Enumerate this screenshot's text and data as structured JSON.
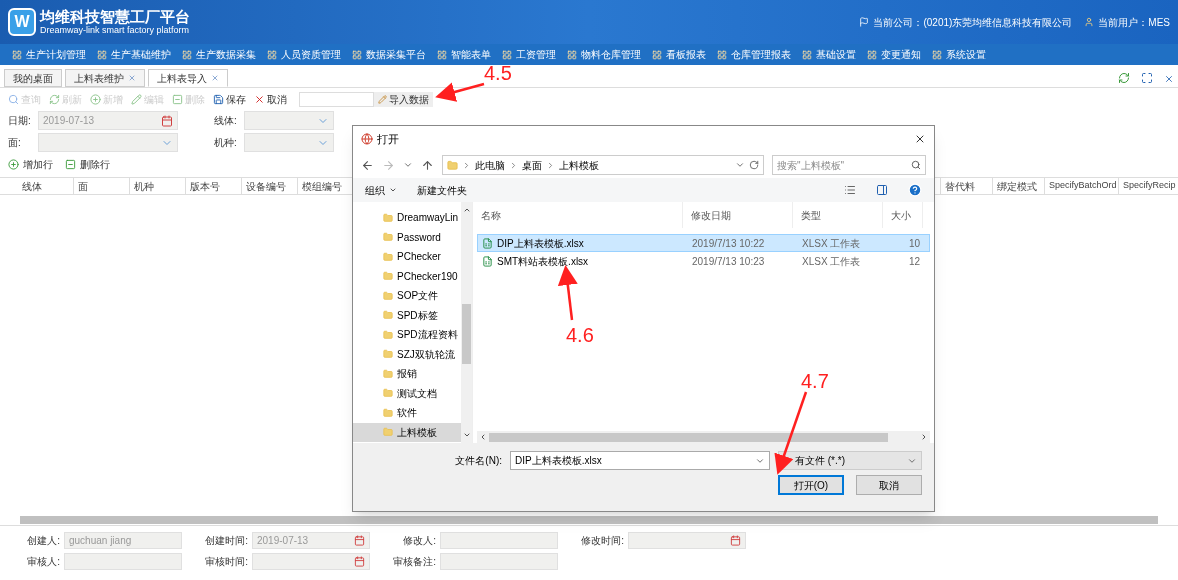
{
  "header": {
    "logo_letter": "W",
    "title": "均维科技智慧工厂平台",
    "subtitle": "Dreamway-link smart factory platform",
    "company": "当前公司：(0201)东莞均维信息科技有限公司",
    "user": "当前用户：MES"
  },
  "menu": [
    "生产计划管理",
    "生产基础维护",
    "生产数据采集",
    "人员资质管理",
    "数据采集平台",
    "智能表单",
    "工资管理",
    "物料仓库管理",
    "看板报表",
    "仓库管理报表",
    "基础设置",
    "变更通知",
    "系统设置"
  ],
  "tabs": [
    {
      "label": "我的桌面",
      "closable": false,
      "selected": false
    },
    {
      "label": "上料表维护",
      "closable": true,
      "selected": false
    },
    {
      "label": "上料表导入",
      "closable": true,
      "selected": true
    }
  ],
  "toolbar": [
    {
      "kind": "search",
      "label": "查询",
      "disabled": true
    },
    {
      "kind": "refresh",
      "label": "刷新",
      "disabled": true
    },
    {
      "kind": "add",
      "label": "新增",
      "disabled": true
    },
    {
      "kind": "edit",
      "label": "编辑",
      "disabled": true
    },
    {
      "kind": "delete",
      "label": "删除",
      "disabled": true
    },
    {
      "kind": "save",
      "label": "保存",
      "disabled": false
    },
    {
      "kind": "cancel",
      "label": "取消",
      "disabled": false
    }
  ],
  "import_button": "导入数据",
  "form_rows": [
    [
      {
        "label": "日期:",
        "value": "2019-07-13",
        "kind": "date"
      },
      {
        "label": "线体:",
        "kind": "select"
      }
    ],
    [
      {
        "label": "面:",
        "kind": "select"
      },
      {
        "label": "机种:",
        "kind": "select"
      }
    ]
  ],
  "row_actions": [
    {
      "kind": "add",
      "label": "增加行"
    },
    {
      "kind": "delete",
      "label": "删除行"
    }
  ],
  "table": {
    "columns_left": [
      "线体",
      "面",
      "机种",
      "版本号",
      "设备编号",
      "模组编号"
    ],
    "columns_right": [
      "替代料",
      "绑定模式",
      "SpecifyBatchOrd",
      "SpecifyRecip"
    ]
  },
  "bottom_form": [
    [
      {
        "label": "创建人:",
        "value": "guchuan jiang",
        "kind": "text"
      },
      {
        "label": "创建时间:",
        "value": "2019-07-13",
        "kind": "date"
      },
      {
        "label": "修改人:",
        "kind": "text"
      },
      {
        "label": "修改时间:",
        "kind": "date"
      }
    ],
    [
      {
        "label": "审核人:",
        "kind": "text"
      },
      {
        "label": "审核时间:",
        "kind": "date"
      },
      {
        "label": "审核备注:",
        "kind": "text"
      }
    ]
  ],
  "dialog": {
    "title": "打开",
    "path": [
      "此电脑",
      "桌面",
      "上料模板"
    ],
    "search_placeholder": "搜索\"上料模板\"",
    "organize": "组织",
    "new_folder": "新建文件夹",
    "tree": [
      {
        "label": "DreamwayLin",
        "selected": false
      },
      {
        "label": "Password",
        "selected": false
      },
      {
        "label": "PChecker",
        "selected": false
      },
      {
        "label": "PChecker190",
        "selected": false
      },
      {
        "label": "SOP文件",
        "selected": false
      },
      {
        "label": "SPD标签",
        "selected": false
      },
      {
        "label": "SPD流程资料",
        "selected": false
      },
      {
        "label": "SZJ双轨轮流",
        "selected": false
      },
      {
        "label": "报销",
        "selected": false
      },
      {
        "label": "测试文档",
        "selected": false
      },
      {
        "label": "软件",
        "selected": false
      },
      {
        "label": "上料模板",
        "selected": true
      }
    ],
    "columns": [
      "名称",
      "修改日期",
      "类型",
      "大小"
    ],
    "files": [
      {
        "name": "DIP上料表模板.xlsx",
        "date": "2019/7/13 10:22",
        "type": "XLSX 工作表",
        "size": "10",
        "selected": true
      },
      {
        "name": "SMT料站表模板.xlsx",
        "date": "2019/7/13 10:23",
        "type": "XLSX 工作表",
        "size": "12",
        "selected": false
      }
    ],
    "filename_label": "文件名(N):",
    "filename_value": "DIP上料表模板.xlsx",
    "filter": "有文件 (*.*)",
    "buttons": [
      {
        "label": "打开(O)",
        "default": true
      },
      {
        "label": "取消",
        "default": false
      }
    ]
  },
  "annotations": [
    "4.5",
    "4.6",
    "4.7"
  ]
}
